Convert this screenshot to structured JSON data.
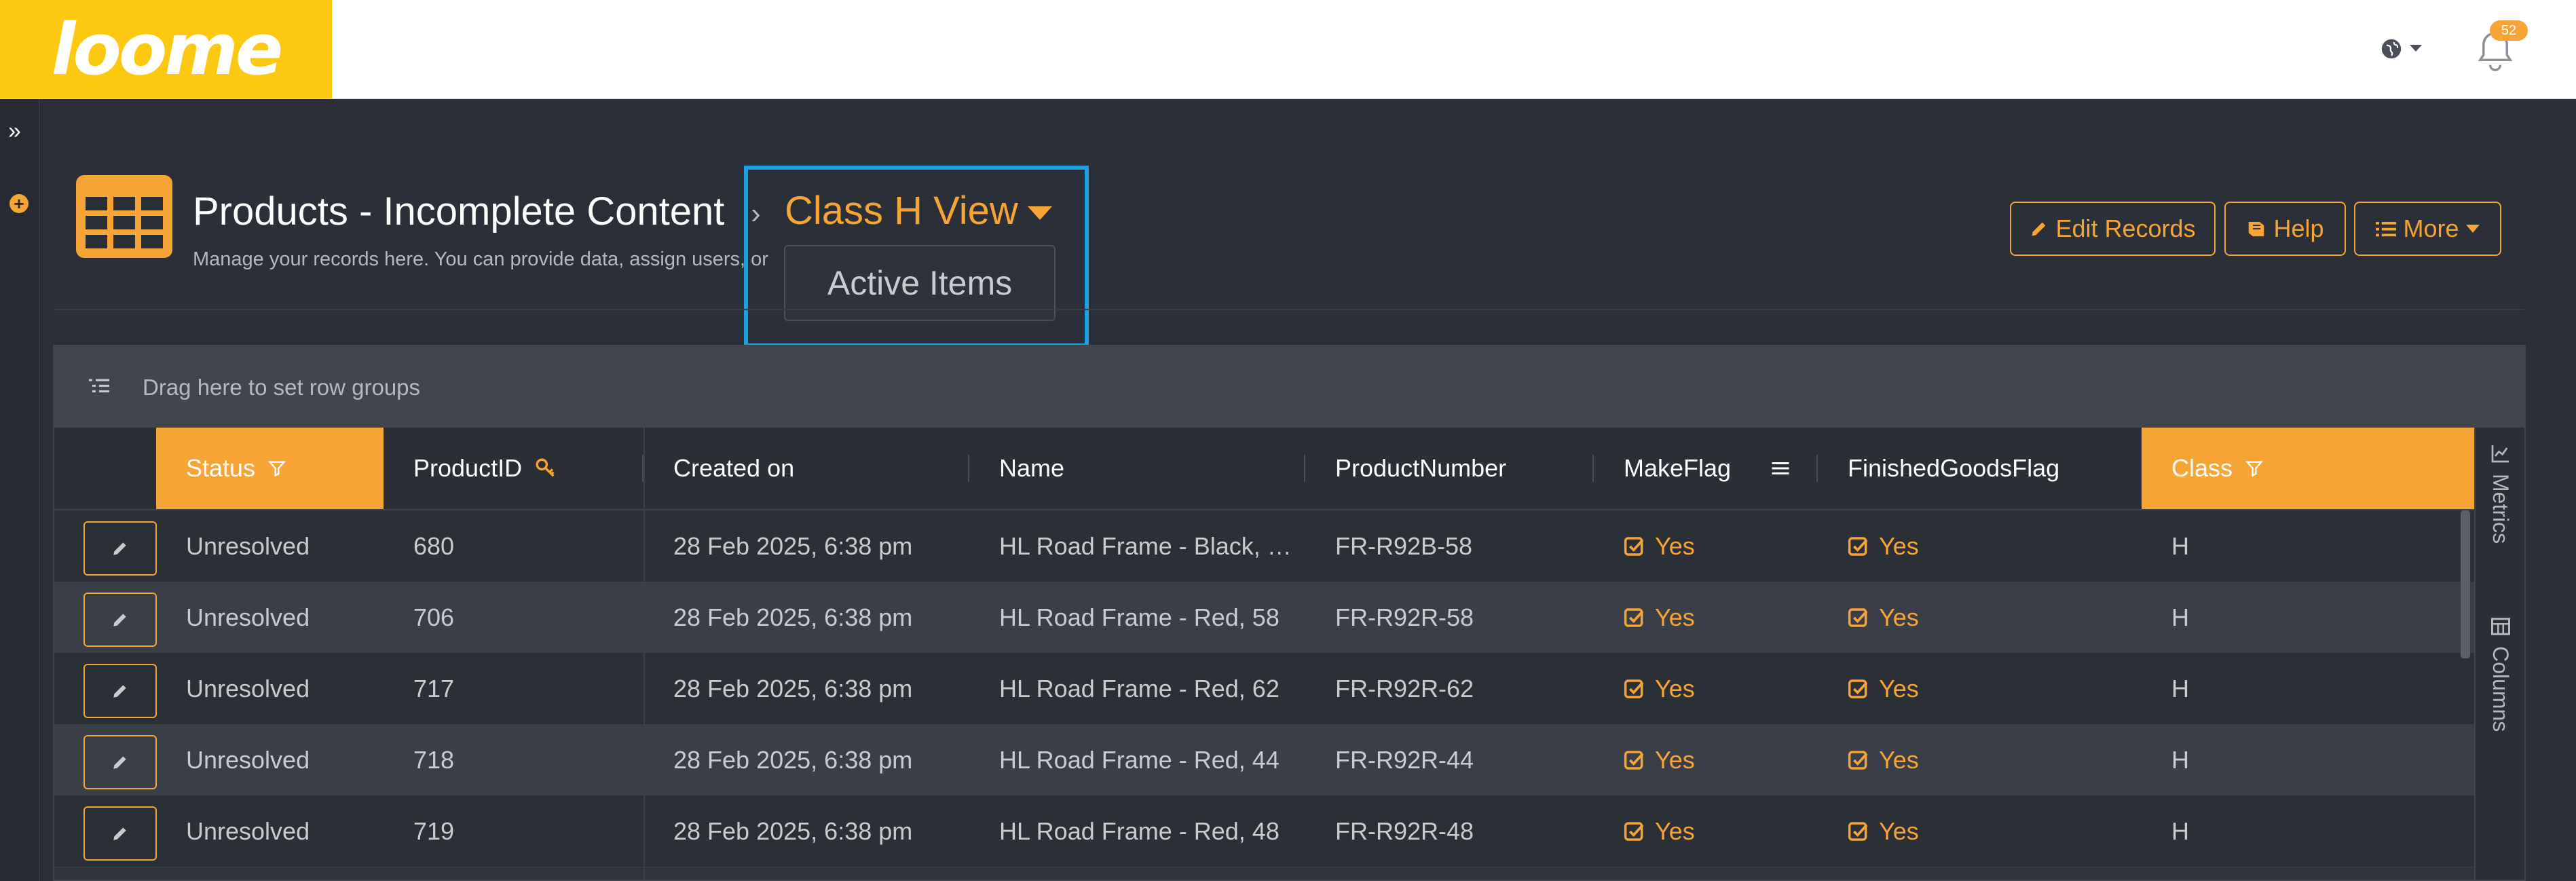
{
  "brand": {
    "logo_text": "loome",
    "accent": "#f7a436",
    "logo_bg": "#fdc811"
  },
  "topbar": {
    "notifications_count": "52"
  },
  "header": {
    "title": "Products - Incomplete Content",
    "subtitle": "Manage your records here. You can provide data, assign users, or",
    "view_title": "Class H View",
    "view_menu": [
      "Active Items"
    ]
  },
  "actions": {
    "edit": "Edit Records",
    "help": "Help",
    "more": "More"
  },
  "grid": {
    "group_hint": "Drag here to set row groups",
    "columns": [
      "Status",
      "ProductID",
      "Created on",
      "Name",
      "ProductNumber",
      "MakeFlag",
      "FinishedGoodsFlag",
      "Class"
    ],
    "rows": [
      {
        "status": "Unresolved",
        "id": "680",
        "created": "28 Feb 2025, 6:38 pm",
        "name": "HL Road Frame - Black, …",
        "number": "FR-R92B-58",
        "make": "Yes",
        "finished": "Yes",
        "class": "H"
      },
      {
        "status": "Unresolved",
        "id": "706",
        "created": "28 Feb 2025, 6:38 pm",
        "name": "HL Road Frame - Red, 58",
        "number": "FR-R92R-58",
        "make": "Yes",
        "finished": "Yes",
        "class": "H"
      },
      {
        "status": "Unresolved",
        "id": "717",
        "created": "28 Feb 2025, 6:38 pm",
        "name": "HL Road Frame - Red, 62",
        "number": "FR-R92R-62",
        "make": "Yes",
        "finished": "Yes",
        "class": "H"
      },
      {
        "status": "Unresolved",
        "id": "718",
        "created": "28 Feb 2025, 6:38 pm",
        "name": "HL Road Frame - Red, 44",
        "number": "FR-R92R-44",
        "make": "Yes",
        "finished": "Yes",
        "class": "H"
      },
      {
        "status": "Unresolved",
        "id": "719",
        "created": "28 Feb 2025, 6:38 pm",
        "name": "HL Road Frame - Red, 48",
        "number": "FR-R92R-48",
        "make": "Yes",
        "finished": "Yes",
        "class": "H"
      }
    ],
    "side_tabs": [
      "Metrics",
      "Columns"
    ]
  }
}
